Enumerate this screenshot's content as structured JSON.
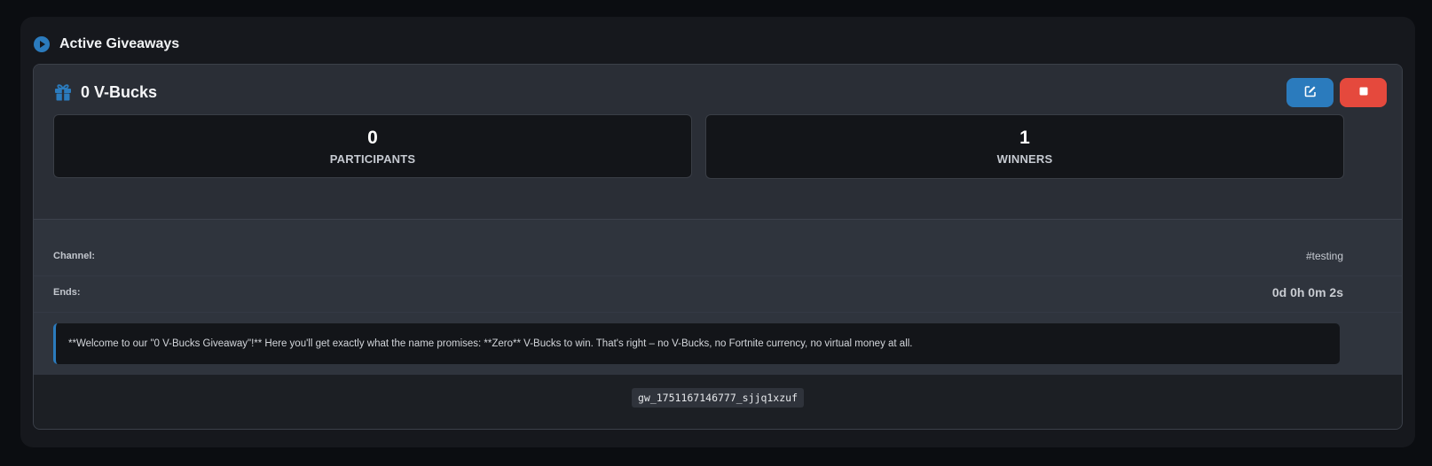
{
  "panel": {
    "title": "Active Giveaways",
    "icon": "play-circle-icon",
    "accent": "#2b7bbd"
  },
  "giveaway": {
    "prize": "0 V-Bucks",
    "prize_icon": "gift-icon",
    "actions": {
      "edit_icon": "edit-icon",
      "stop_icon": "stop-icon",
      "edit_color": "#2b7bbd",
      "stop_color": "#e5493d"
    },
    "stats": {
      "participants": {
        "value": "0",
        "label": "PARTICIPANTS"
      },
      "winners": {
        "value": "1",
        "label": "WINNERS"
      }
    },
    "details": {
      "channel_label": "Channel:",
      "channel_value": "#testing",
      "ends_label": "Ends:",
      "ends_value": "0d 0h 0m 2s"
    },
    "description": "**Welcome to our \"0 V-Bucks Giveaway\"!** Here you'll get exactly what the name promises: **Zero** V-Bucks to win. That's right – no V-Bucks, no Fortnite currency, no virtual money at all.",
    "id": "gw_1751167146777_sjjq1xzuf"
  }
}
